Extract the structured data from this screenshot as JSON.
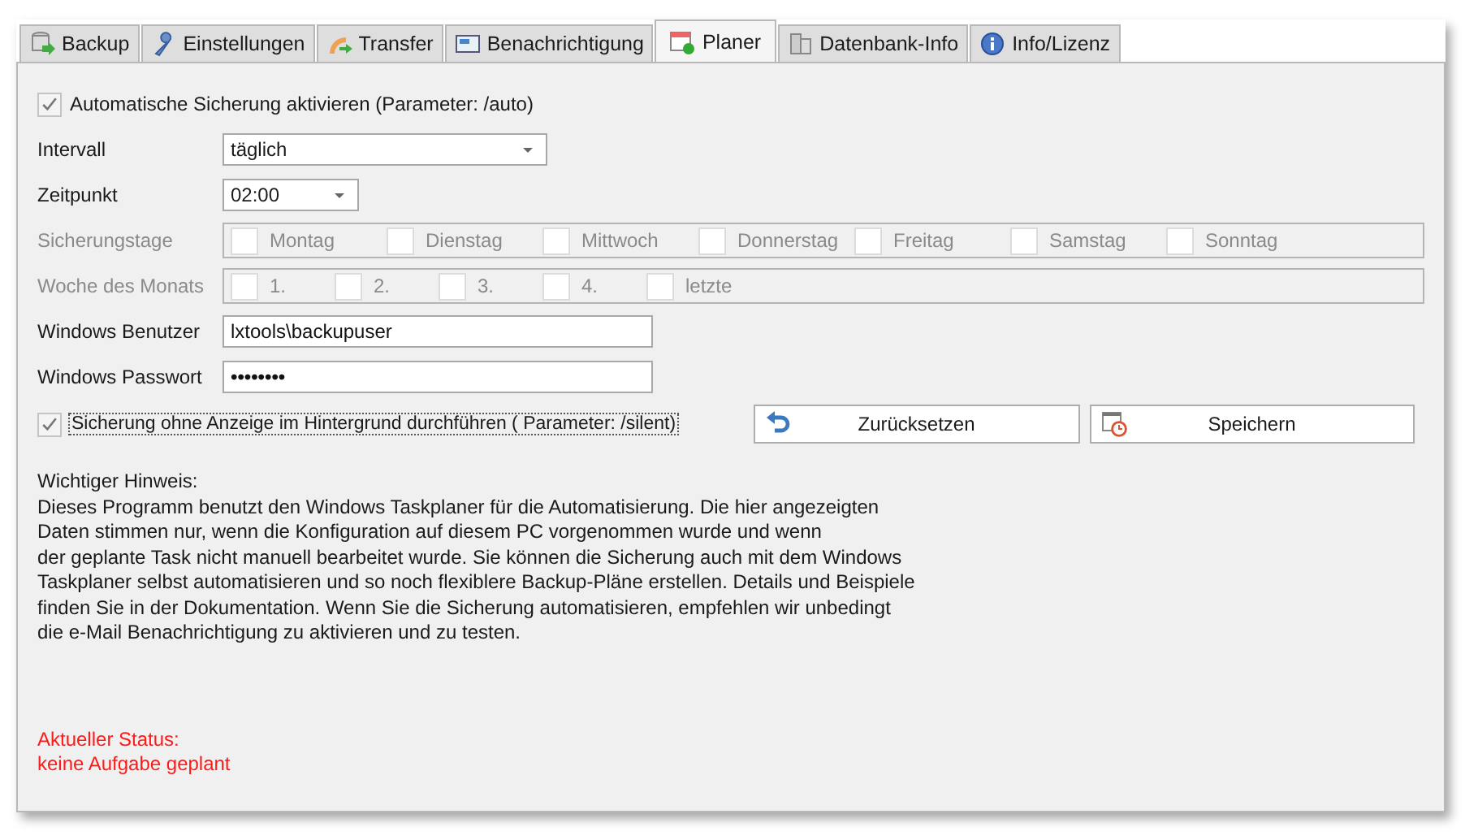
{
  "tabs": [
    {
      "label": "Backup",
      "selected": false
    },
    {
      "label": "Einstellungen",
      "selected": false
    },
    {
      "label": "Transfer",
      "selected": false
    },
    {
      "label": "Benachrichtigung",
      "selected": false
    },
    {
      "label": "Planer",
      "selected": true
    },
    {
      "label": "Datenbank-Info",
      "selected": false
    },
    {
      "label": "Info/Lizenz",
      "selected": false
    }
  ],
  "auto_backup": {
    "label": "Automatische Sicherung aktivieren (Parameter: /auto)",
    "checked": true
  },
  "interval": {
    "label": "Intervall",
    "value": "täglich"
  },
  "time": {
    "label": "Zeitpunkt",
    "value": "02:00"
  },
  "backup_days": {
    "label": "Sicherungstage",
    "disabled": true,
    "items": [
      {
        "label": "Montag",
        "checked": false
      },
      {
        "label": "Dienstag",
        "checked": false
      },
      {
        "label": "Mittwoch",
        "checked": false
      },
      {
        "label": "Donnerstag",
        "checked": false
      },
      {
        "label": "Freitag",
        "checked": false
      },
      {
        "label": "Samstag",
        "checked": false
      },
      {
        "label": "Sonntag",
        "checked": false
      }
    ]
  },
  "week_of_month": {
    "label": "Woche des Monats",
    "disabled": true,
    "items": [
      {
        "label": "1.",
        "checked": false
      },
      {
        "label": "2.",
        "checked": false
      },
      {
        "label": "3.",
        "checked": false
      },
      {
        "label": "4.",
        "checked": false
      },
      {
        "label": "letzte",
        "checked": false
      }
    ]
  },
  "user": {
    "label": "Windows Benutzer",
    "value": "lxtools\\backupuser"
  },
  "password": {
    "label": "Windows Passwort",
    "value": "••••••••"
  },
  "silent": {
    "label": "Sicherung ohne Anzeige im Hintergrund durchführen ( Parameter: /silent)",
    "checked": true
  },
  "buttons": [
    {
      "label": "Zurücksetzen"
    },
    {
      "label": "Speichern"
    }
  ],
  "note": {
    "heading": "Wichtiger Hinweis:",
    "lines": [
      "Dieses Programm benutzt den Windows Taskplaner für die Automatisierung. Die hier angezeigten",
      "Daten stimmen nur, wenn die Konfiguration auf diesem PC vorgenommen wurde und wenn",
      "der geplante Task nicht manuell bearbeitet wurde. Sie können die Sicherung  auch mit dem Windows",
      "Taskplaner selbst automatisieren und so noch flexiblere Backup-Pläne erstellen. Details und Beispiele",
      "finden Sie in der Dokumentation. Wenn Sie die Sicherung automatisieren, empfehlen wir unbedingt",
      "die e-Mail Benachrichtigung zu aktivieren und zu testen."
    ]
  },
  "status": {
    "heading": "Aktueller Status:",
    "value": "keine Aufgabe geplant"
  }
}
